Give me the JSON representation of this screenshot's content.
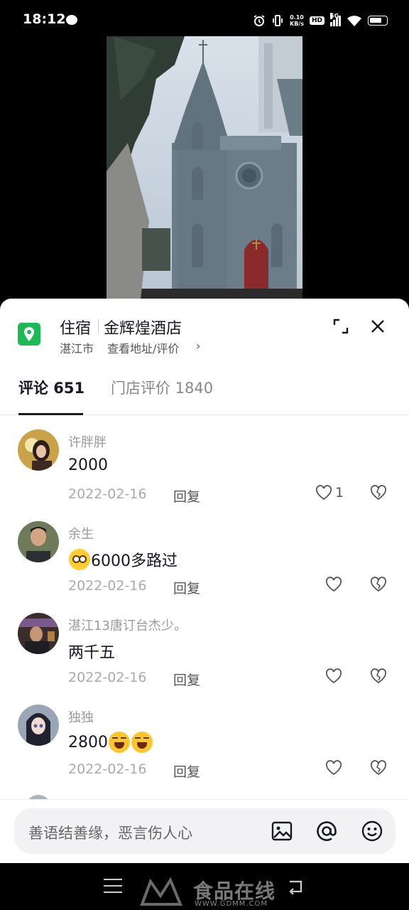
{
  "status_bar": {
    "time": "18:12",
    "net_speed_value": "0.10",
    "net_speed_unit": "KB/s",
    "hd_label": "HD",
    "network_label": "5G",
    "icons": [
      "chat-bubble-icon",
      "alarm-icon",
      "vibrate-icon",
      "signal-icon",
      "wifi-icon",
      "battery-icon"
    ]
  },
  "poi": {
    "category": "住宿",
    "name": "金辉煌酒店",
    "city": "湛江市",
    "link": "查看地址/评价",
    "chevron": "›",
    "brand_color": "#1db954"
  },
  "tabs": [
    {
      "label": "评论 651",
      "active": true
    },
    {
      "label": "门店评价 1840",
      "active": false
    }
  ],
  "comments": [
    {
      "user": "许胖胖",
      "text": "2000",
      "date": "2022-02-16",
      "reply": "回复",
      "likes": "1"
    },
    {
      "user": "余生",
      "text": "6000多路过",
      "date": "2022-02-16",
      "reply": "回复",
      "likes": ""
    },
    {
      "user": "湛江13唐订台杰少。",
      "text": "两千五",
      "date": "2022-02-16",
      "reply": "回复",
      "likes": ""
    },
    {
      "user": "独独",
      "text": "2800",
      "date": "2022-02-16",
      "reply": "回复",
      "likes": ""
    }
  ],
  "input": {
    "placeholder": "善语结善缘，恶言伤人心",
    "icons": [
      "image-icon",
      "at-icon",
      "emoji-icon"
    ]
  },
  "watermark": {
    "text": "食品在线",
    "url": "WWW.GDMM.COM"
  }
}
